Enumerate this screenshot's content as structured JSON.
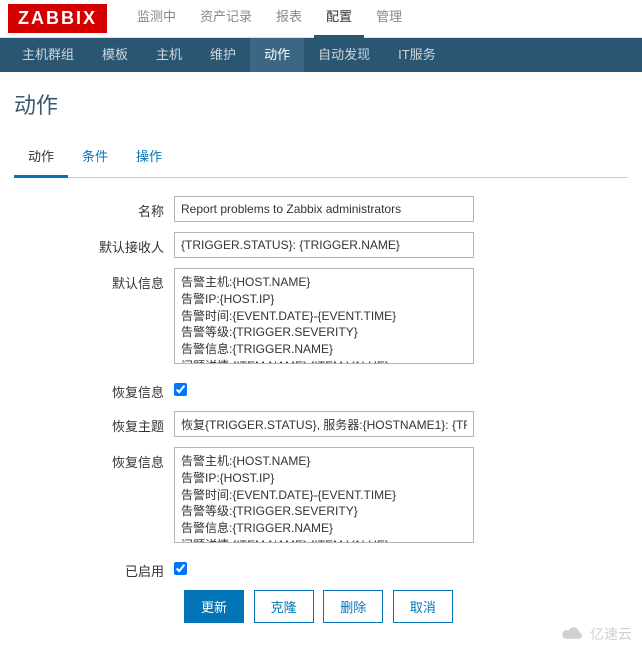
{
  "logo": "ZABBIX",
  "topnav": {
    "items": [
      "监测中",
      "资产记录",
      "报表",
      "配置",
      "管理"
    ],
    "active": 3
  },
  "subnav": {
    "items": [
      "主机群组",
      "模板",
      "主机",
      "维护",
      "动作",
      "自动发现",
      "IT服务"
    ],
    "active": 4
  },
  "page_title": "动作",
  "tabs": {
    "items": [
      "动作",
      "条件",
      "操作"
    ],
    "active": 0
  },
  "form": {
    "name_label": "名称",
    "name_value": "Report problems to Zabbix administrators",
    "default_recipient_label": "默认接收人",
    "default_recipient_value": "{TRIGGER.STATUS}: {TRIGGER.NAME}",
    "default_message_label": "默认信息",
    "default_message_value": "告警主机:{HOST.NAME}\n告警IP:{HOST.IP}\n告警时间:{EVENT.DATE}-{EVENT.TIME}\n告警等级:{TRIGGER.SEVERITY}\n告警信息:{TRIGGER.NAME}\n问题详情:{ITEM.NAME}:{ITEM.VALUE}",
    "recovery_info_label": "恢复信息",
    "recovery_info_checked": true,
    "recovery_subject_label": "恢复主题",
    "recovery_subject_value": "恢复{TRIGGER.STATUS}, 服务器:{HOSTNAME1}: {TR",
    "recovery_message_label": "恢复信息",
    "recovery_message_value": "告警主机:{HOST.NAME}\n告警IP:{HOST.IP}\n告警时间:{EVENT.DATE}-{EVENT.TIME}\n告警等级:{TRIGGER.SEVERITY}\n告警信息:{TRIGGER.NAME}\n问题详情:{ITEM.NAME}:{ITEM.VALUE}",
    "enabled_label": "已启用",
    "enabled_checked": true
  },
  "buttons": {
    "update": "更新",
    "clone": "克隆",
    "delete": "删除",
    "cancel": "取消"
  },
  "watermark": "亿速云"
}
